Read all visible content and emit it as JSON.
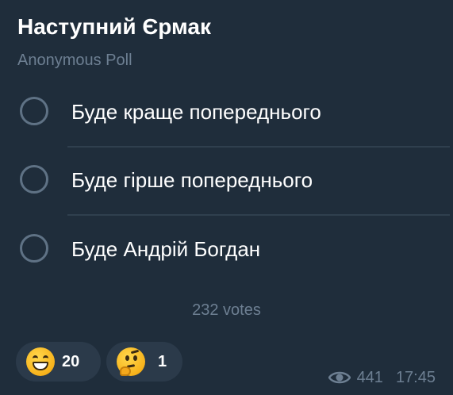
{
  "poll": {
    "title": "Наступний Єрмак",
    "type_label": "Anonymous Poll",
    "options": [
      {
        "label": "Буде краще попереднього"
      },
      {
        "label": "Буде гірше попереднього"
      },
      {
        "label": "Буде Андрій Богдан"
      }
    ],
    "votes_label": "232 votes"
  },
  "reactions": [
    {
      "emoji": "grinning-face-icon",
      "count": "20"
    },
    {
      "emoji": "thinking-face-icon",
      "count": "1"
    }
  ],
  "meta": {
    "views": "441",
    "time": "17:45"
  },
  "colors": {
    "background": "#1f2d3b",
    "title": "#ffffff",
    "muted": "#6d7f92",
    "radio_border": "#5f7285",
    "divider": "#2f3f4e",
    "reaction_pill": "#2b3a4a"
  }
}
